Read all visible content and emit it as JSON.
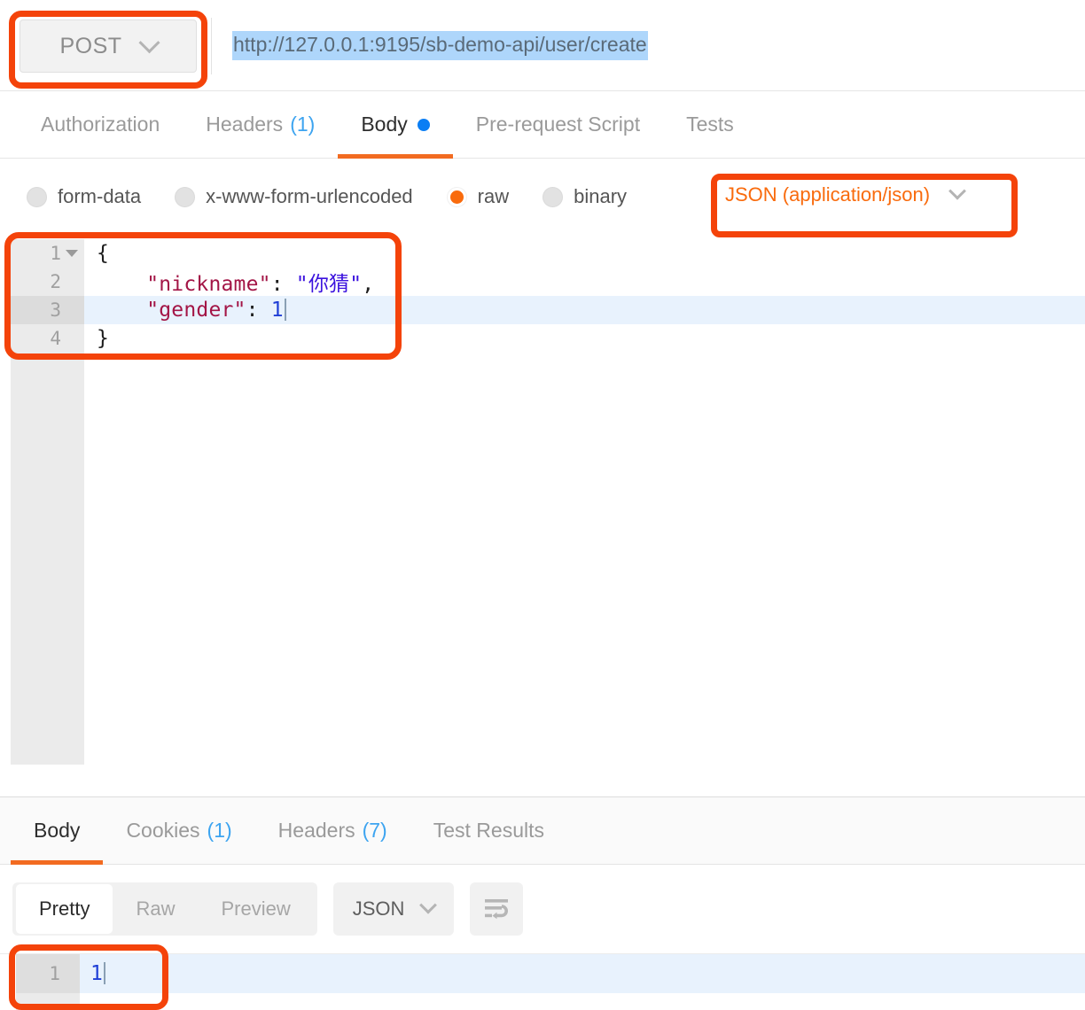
{
  "request": {
    "method": "POST",
    "url": "http://127.0.0.1:9195/sb-demo-api/user/create",
    "tabs": [
      {
        "label": "Authorization",
        "count": "",
        "active": false
      },
      {
        "label": "Headers",
        "count": "(1)",
        "active": false
      },
      {
        "label": "Body",
        "count": "",
        "active": true,
        "dot": true
      },
      {
        "label": "Pre-request Script",
        "count": "",
        "active": false
      },
      {
        "label": "Tests",
        "count": "",
        "active": false
      }
    ],
    "body_types": [
      {
        "label": "form-data",
        "selected": false
      },
      {
        "label": "x-www-form-urlencoded",
        "selected": false
      },
      {
        "label": "raw",
        "selected": true
      },
      {
        "label": "binary",
        "selected": false
      }
    ],
    "content_type": "JSON (application/json)",
    "editor": {
      "lines": [
        {
          "num": "1",
          "fold": true,
          "active": false,
          "text": "{"
        },
        {
          "num": "2",
          "fold": false,
          "active": false,
          "key": "\"nickname\"",
          "sep": ": ",
          "value": "\"你猜\"",
          "tail": ","
        },
        {
          "num": "3",
          "fold": false,
          "active": true,
          "key": "\"gender\"",
          "sep": ": ",
          "number": "1"
        },
        {
          "num": "4",
          "fold": false,
          "active": false,
          "text": "}"
        }
      ]
    }
  },
  "response": {
    "tabs": [
      {
        "label": "Body",
        "count": "",
        "active": true
      },
      {
        "label": "Cookies",
        "count": "(1)",
        "active": false
      },
      {
        "label": "Headers",
        "count": "(7)",
        "active": false
      },
      {
        "label": "Test Results",
        "count": "",
        "active": false
      }
    ],
    "view_modes": [
      {
        "label": "Pretty",
        "active": true
      },
      {
        "label": "Raw",
        "active": false
      },
      {
        "label": "Preview",
        "active": false
      }
    ],
    "format": "JSON",
    "body": {
      "lines": [
        {
          "num": "1",
          "text": "1"
        }
      ]
    }
  },
  "colors": {
    "accent_orange": "#f26b21",
    "annotation_red": "#f4430a",
    "link_blue": "#3da4f0",
    "selection_blue": "#aed6fb",
    "active_line_blue": "#e8f2fd",
    "json_key": "#a31546",
    "json_string": "#3b12de",
    "json_number": "#1f3fd6"
  }
}
